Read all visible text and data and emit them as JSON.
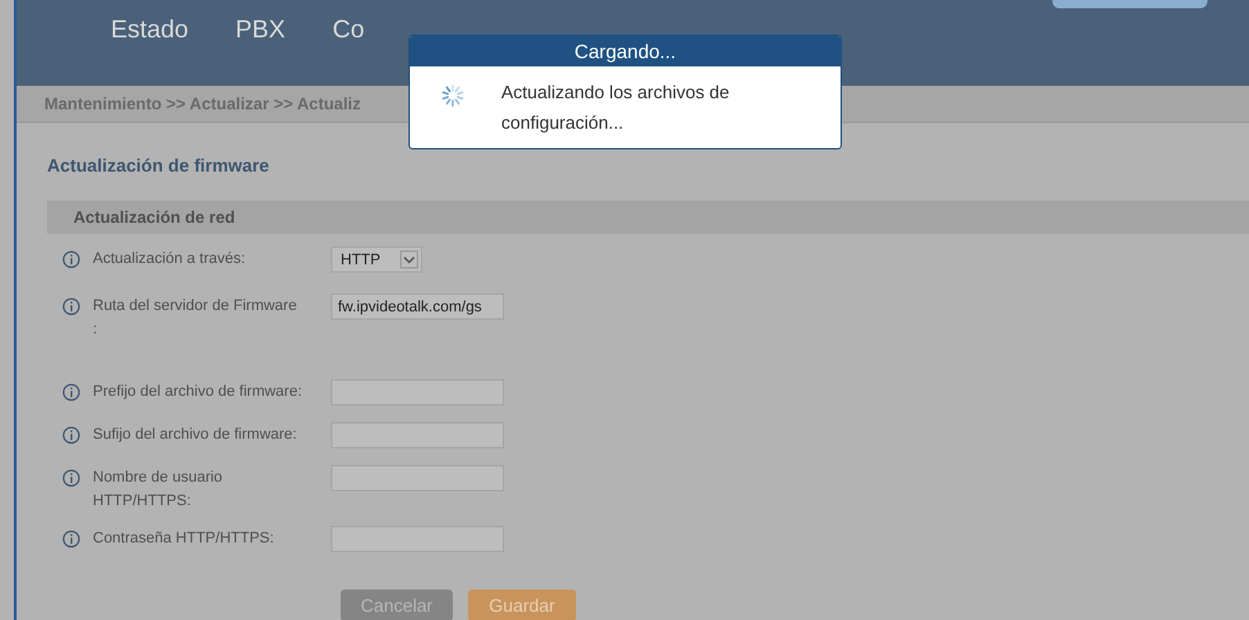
{
  "nav": [
    "Estado",
    "PBX",
    "Co"
  ],
  "breadcrumb": "Mantenimiento >> Actualizar >> Actualiz",
  "dialog": {
    "title": "Cargando...",
    "message": "Actualizando los archivos de configuración..."
  },
  "page_title": "Actualización de firmware",
  "section": "Actualización de red",
  "fields": [
    {
      "kind": "select",
      "label": "Actualización a través:",
      "value": "HTTP"
    },
    {
      "kind": "text",
      "label": "Ruta del servidor de Firmware\n:",
      "value": "fw.ipvideotalk.com/gs"
    },
    {
      "kind": "text",
      "label": "Prefijo del archivo de firmware:"
    },
    {
      "kind": "text",
      "label": "Sufijo del archivo de firmware:"
    },
    {
      "kind": "text",
      "label": "Nombre de usuario\nHTTP/HTTPS:"
    },
    {
      "kind": "password",
      "label": "Contraseña HTTP/HTTPS:"
    }
  ],
  "buttons": [
    {
      "kind": "cancel",
      "label": "Cancelar"
    },
    {
      "kind": "save",
      "label": "Guardar"
    }
  ]
}
